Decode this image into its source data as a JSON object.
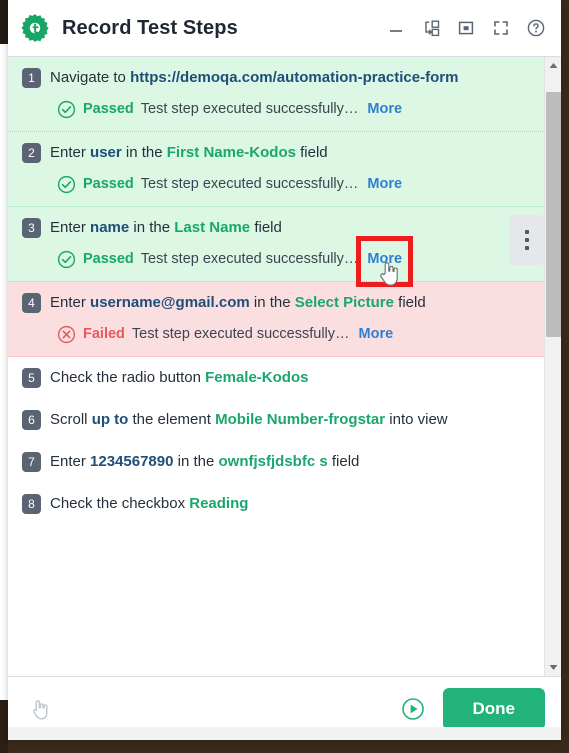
{
  "window": {
    "title": "Record Test Steps",
    "logo_icon": "green-gear-icon",
    "controls": [
      {
        "name": "minimize-button",
        "icon": "minimize-icon",
        "label": "Minimize"
      },
      {
        "name": "popout-button",
        "icon": "popout-window-icon",
        "label": "Pop out"
      },
      {
        "name": "restore-button",
        "icon": "restore-window-icon",
        "label": "Restore"
      },
      {
        "name": "fullscreen-button",
        "icon": "fullscreen-icon",
        "label": "Full screen"
      },
      {
        "name": "help-button",
        "icon": "help-circle-icon",
        "label": "Help"
      }
    ]
  },
  "steps": [
    {
      "number": "1",
      "state": "passed",
      "action": "Navigate to",
      "value": "https://demoqa.com/automation-practice-form",
      "value_kind": "url",
      "middle": "",
      "target": "",
      "suffix": "",
      "status": "Passed",
      "status_icon": "check-circle-icon",
      "message": "Test step executed successfully…",
      "more": "More"
    },
    {
      "number": "2",
      "state": "passed",
      "action": "Enter",
      "value": "user",
      "value_kind": "val",
      "middle": "in the",
      "target": "First Name-Kodos",
      "suffix": "field",
      "status": "Passed",
      "status_icon": "check-circle-icon",
      "message": "Test step executed successfully…",
      "more": "More"
    },
    {
      "number": "3",
      "state": "passed",
      "hovered": true,
      "action": "Enter",
      "value": "name",
      "value_kind": "val",
      "middle": "in the",
      "target": "Last Name",
      "suffix": "field",
      "status": "Passed",
      "status_icon": "check-circle-icon",
      "message": "Test step executed successfully…",
      "more": "More",
      "highlighted": true,
      "kebab_icon": "more-vertical-icon"
    },
    {
      "number": "4",
      "state": "failed",
      "action": "Enter",
      "value": "username@gmail.com",
      "value_kind": "val",
      "middle": "in the",
      "target": "Select Picture",
      "suffix": "field",
      "status": "Failed",
      "status_icon": "x-circle-icon",
      "message": "Test step executed successfully…",
      "more": "More"
    },
    {
      "number": "5",
      "state": "plain",
      "action": "Check the radio button",
      "value": "",
      "value_kind": "val",
      "middle": "",
      "target": "Female-Kodos",
      "suffix": ""
    },
    {
      "number": "6",
      "state": "plain",
      "action": "Scroll",
      "value": "up to",
      "value_kind": "val",
      "middle": "the element",
      "target": "Mobile Number-frogstar",
      "suffix": "into view"
    },
    {
      "number": "7",
      "state": "plain",
      "action": "Enter",
      "value": "1234567890",
      "value_kind": "val",
      "middle": "in the",
      "target": "ownfjsfjdsbfc s",
      "suffix": "field"
    },
    {
      "number": "8",
      "state": "plain",
      "action": "Check the checkbox",
      "value": "",
      "value_kind": "val",
      "middle": "",
      "target": "Reading",
      "suffix": ""
    }
  ],
  "footer": {
    "pick_element_icon": "hand-pointer-icon",
    "run_icon": "play-circle-icon",
    "done_label": "Done"
  },
  "scrollbar": {
    "up_icon": "caret-up-icon",
    "down_icon": "caret-down-icon",
    "thumb_top_pct": 3,
    "thumb_height_pct": 42
  },
  "colors": {
    "accent_green": "#21b37a",
    "pass_bg": "#dcf7e3",
    "fail_bg": "#fbdfe0",
    "pass_text": "#1aa66e",
    "fail_text": "#e8595f",
    "link_blue": "#2f7fd1",
    "highlight_red": "#ee1c1c",
    "badge_gray": "#5a6473"
  }
}
